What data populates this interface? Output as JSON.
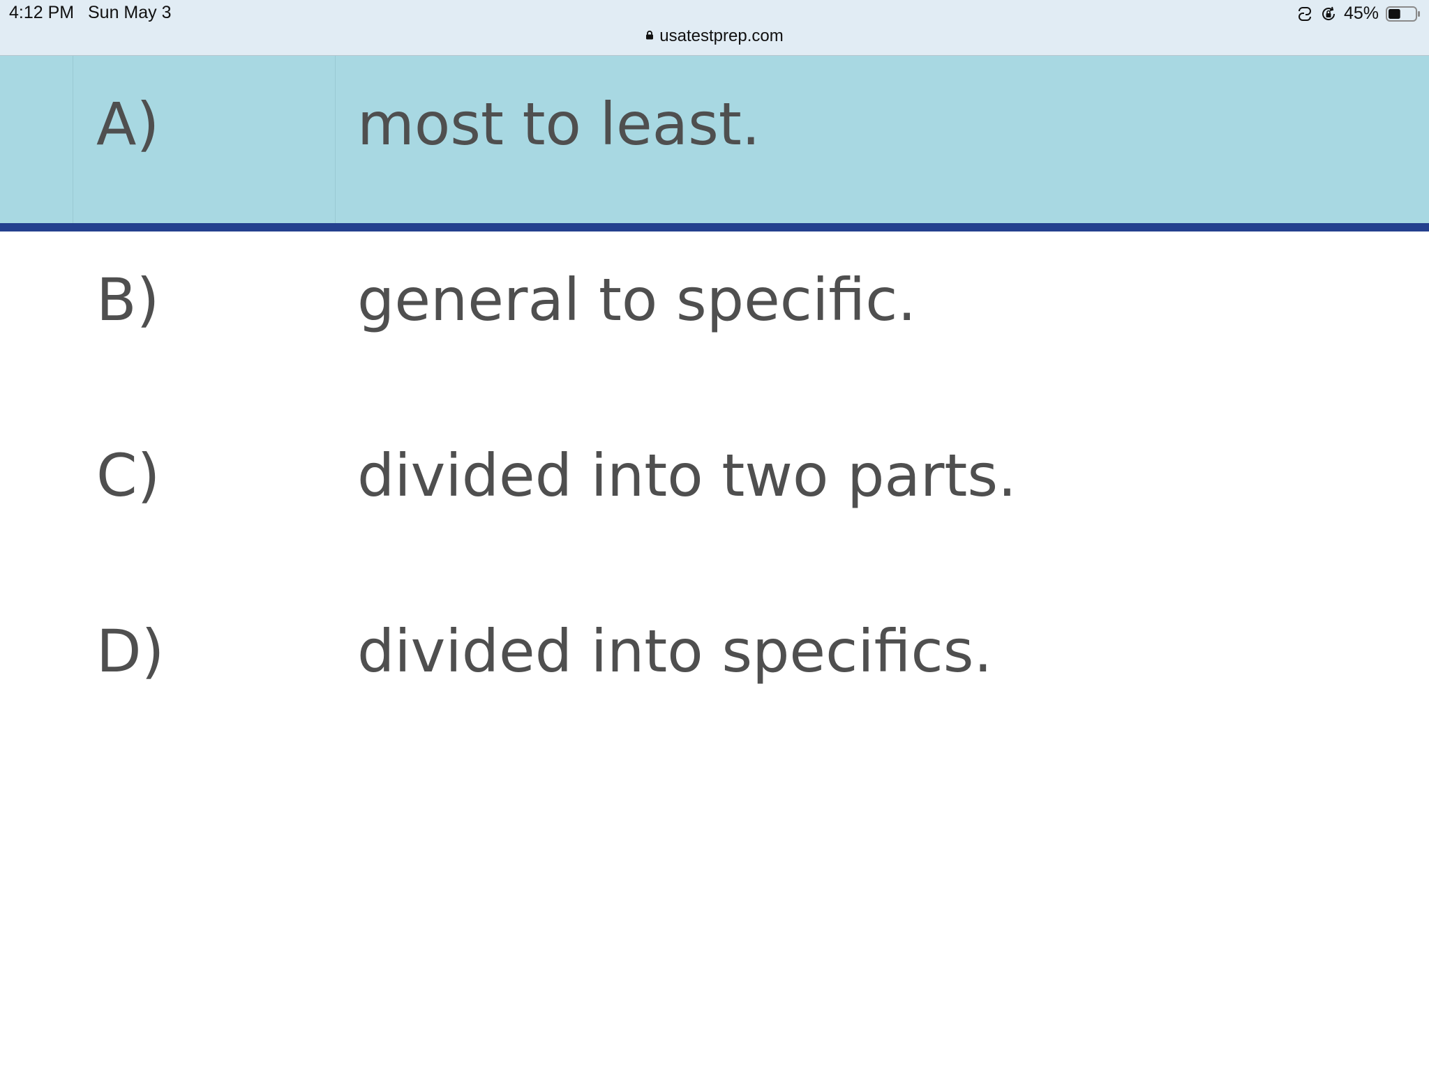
{
  "status_bar": {
    "time": "4:12 PM",
    "date": "Sun May 3",
    "url": "usatestprep.com",
    "battery_percent": "45%",
    "battery_level": 0.45,
    "icons": [
      "lock-icon",
      "screen-mirroring-icon",
      "orientation-lock-icon",
      "battery-icon"
    ]
  },
  "answers": [
    {
      "letter": "A)",
      "text": "most to least.",
      "selected": true
    },
    {
      "letter": "B)",
      "text": "general to specific.",
      "selected": false
    },
    {
      "letter": "C)",
      "text": "divided into two parts.",
      "selected": false
    },
    {
      "letter": "D)",
      "text": "divided into specifics.",
      "selected": false
    }
  ],
  "colors": {
    "status_bar_bg": "#e1ecf4",
    "selected_bg": "#a8d8e2",
    "selected_border": "#24408e",
    "answer_text": "#4f4f4f"
  }
}
